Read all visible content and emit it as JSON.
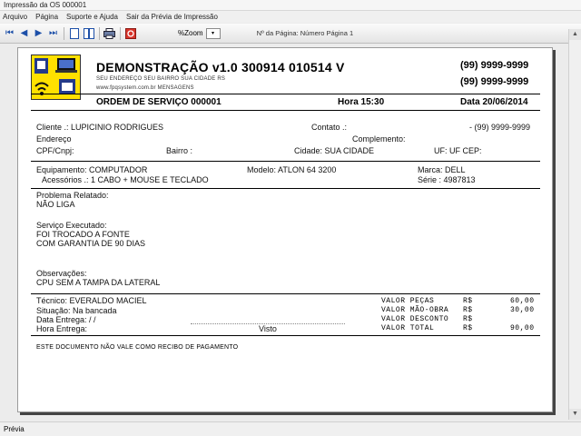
{
  "window": {
    "title": "Impressão da OS 000001"
  },
  "menu": {
    "items": [
      "Arquivo",
      "Página",
      "Suporte e Ajuda",
      "Sair da Prévia de Impressão"
    ]
  },
  "toolbar": {
    "zoom_label": "%Zoom",
    "zoom_value": "▾",
    "page_info": "Nº da Página: Número Página 1"
  },
  "status": {
    "text": "Prévia"
  },
  "doc": {
    "company": "DEMONSTRAÇÃO v1.0 300914 010514 V",
    "address": "SEU ENDEREÇO  SEU BAIRRO  SUA CIDADE  RS",
    "site": "www.fpqsystem.com.br  MENSAGENS",
    "phone1": "(99) 9999-9999",
    "phone2": "(99) 9999-9999",
    "os_title": "ORDEM DE SERVIÇO  000001",
    "hora": "Hora 15:30",
    "data": "Data 20/06/2014",
    "cliente": "Cliente    .: LUPICINIO RODRIGUES",
    "contato": "Contato .:",
    "cliente_phone": "- (99) 9999-9999",
    "endereco": "Endereço",
    "complemento": "Complemento:",
    "cpf": "CPF/Cnpj:",
    "bairro": "Bairro :",
    "cidade": "Cidade: SUA CIDADE",
    "uf": "UF: UF  CEP:",
    "equipamento": "Equipamento: COMPUTADOR",
    "modelo": "Modelo: ATLON 64 3200",
    "marca": "Marca: DELL",
    "acessorios": "Acessórios .: 1 CABO + MOUSE E TECLADO",
    "serie": "Série  : 4987813",
    "problema_label": "Problema Relatado:",
    "problema": "NÃO LIGA",
    "servico_label": "Serviço Executado:",
    "servico_1": "FOI TROCADO A FONTE",
    "servico_2": "COM GARANTIA DE 90 DIAS",
    "obs_label": "Observações:",
    "obs": "CPU SEM A TAMPA DA LATERAL",
    "tecnico": "Técnico: EVERALDO MACIEL",
    "situacao": "Situação: Na bancada",
    "data_entrega": "Data Entrega:   /  /",
    "hora_entrega": "Hora Entrega:",
    "visto": "Visto",
    "valor_pecas_label": "VALOR PEÇAS",
    "valor_mao_label": "VALOR MÃO-OBRA",
    "valor_desc_label": "VALOR DESCONTO",
    "valor_total_label": "VALOR TOTAL",
    "currency": "R$",
    "valor_pecas": "60,00",
    "valor_mao": "30,00",
    "valor_total": "90,00",
    "footer_note": "ESTE DOCUMENTO NÃO VALE COMO RECIBO DE PAGAMENTO"
  }
}
